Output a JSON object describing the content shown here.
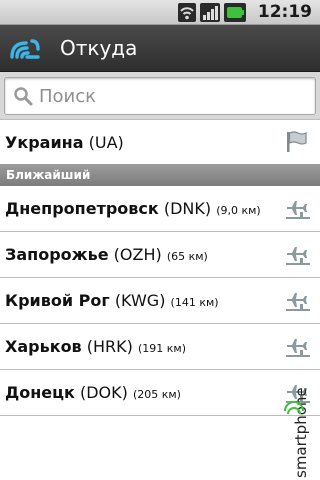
{
  "status_bar": {
    "time": "12:19",
    "icons": [
      "wifi-icon",
      "signal-icon",
      "battery-icon"
    ],
    "battery_color": "#3ec23e"
  },
  "action_bar": {
    "app_icon": "logo-wave-icon",
    "title": "Откуда",
    "accent": "#3bb6e8"
  },
  "search": {
    "placeholder": "Поиск",
    "value": ""
  },
  "country": {
    "name": "Украина",
    "code": "(UA)",
    "icon": "flag-icon"
  },
  "section": {
    "title": "Ближайший"
  },
  "airports": [
    {
      "city": "Днепропетровск",
      "code": "(DNK)",
      "distance": "(9,0 км)"
    },
    {
      "city": "Запорожье",
      "code": "(OZH)",
      "distance": "(65 км)"
    },
    {
      "city": "Кривой Рог",
      "code": "(KWG)",
      "distance": "(141 км)"
    },
    {
      "city": "Харьков",
      "code": "(HRK)",
      "distance": "(191 км)"
    },
    {
      "city": "Донецк",
      "code": "(DOK)",
      "distance": "(205 км)"
    }
  ],
  "watermark": {
    "text": "smartphone"
  }
}
